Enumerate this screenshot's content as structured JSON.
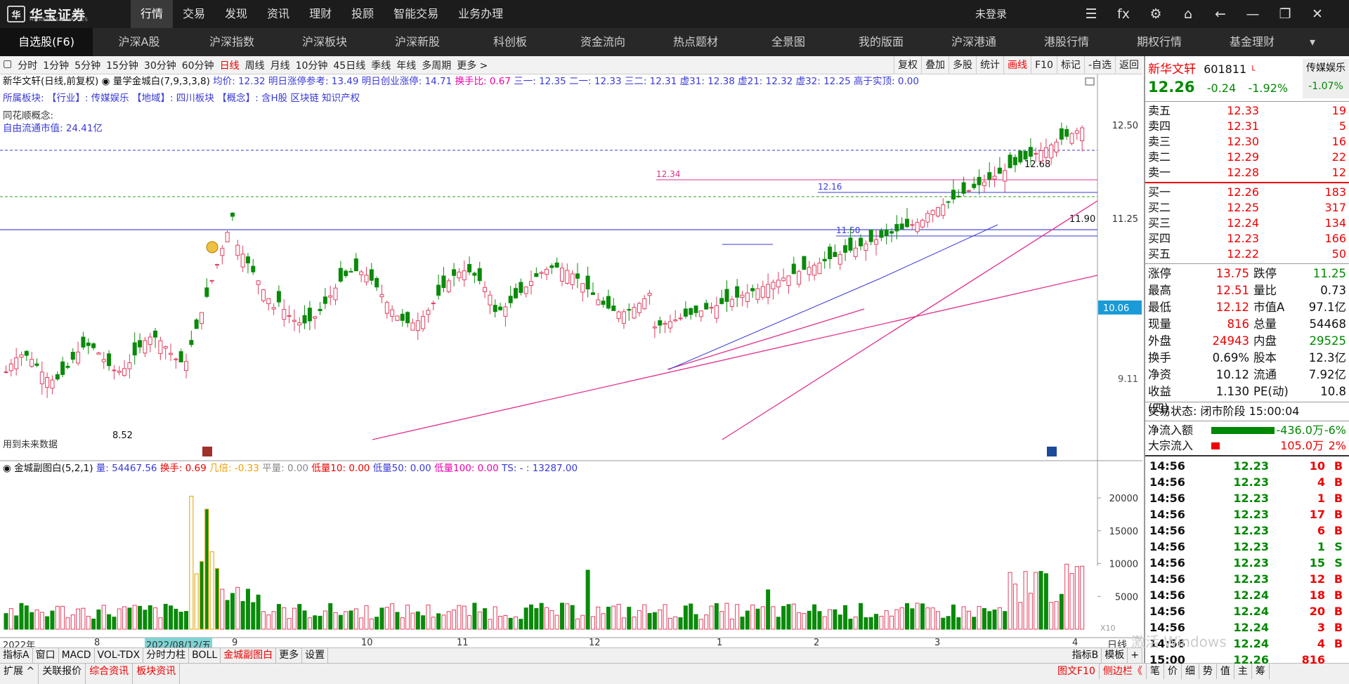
{
  "app": {
    "logo_text": "华宝证券",
    "logo_sub": "HWABAO SECURITIES",
    "login": "未登录"
  },
  "top_menu": [
    "行情",
    "交易",
    "发现",
    "资讯",
    "理财",
    "投顾",
    "智能交易",
    "业务办理"
  ],
  "top_icons": [
    "list-icon",
    "fx-icon",
    "gear-icon",
    "shirt-icon",
    "back-icon",
    "minimize-icon",
    "restore-icon",
    "close-icon"
  ],
  "top_icon_glyphs": [
    "☰",
    "fx",
    "⚙",
    "⌂",
    "←",
    "—",
    "❐",
    "✕"
  ],
  "navbar": [
    "自选股(F6)",
    "沪深A股",
    "沪深指数",
    "沪深板块",
    "沪深新股",
    "科创板",
    "资金流向",
    "热点题材",
    "全景图",
    "我的版面",
    "沪深港通",
    "港股行情",
    "期权行情",
    "基金理财"
  ],
  "periods": [
    "▢",
    "分时",
    "1分钟",
    "5分钟",
    "15分钟",
    "30分钟",
    "60分钟",
    "日线",
    "周线",
    "月线",
    "10分钟",
    "45日线",
    "季线",
    "年线",
    "多周期",
    "更多 >"
  ],
  "active_period": "日线",
  "tool_buttons": [
    "复权",
    "叠加",
    "多股",
    "统计",
    "画线",
    "F10",
    "标记",
    "-自选",
    "返回"
  ],
  "info_line": {
    "name": "新华文轩(日线,前复权)",
    "indicator": "量学金城白(7,9,3,3,8)",
    "avg": "均价: 12.32",
    "limit_ref": "明日涨停参考: 13.49",
    "cy_limit": "明日创业涨停: 14.71",
    "turnover": "换手比: 0.67",
    "s1": "三一: 12.35",
    "s2": "二一: 12.33",
    "s3": "三二: 12.31",
    "x31": "虚31: 12.38",
    "x21": "虚21: 12.32",
    "x32": "虚32: 12.25",
    "above": "高于实顶: 0.00"
  },
  "sector_line": "所属板块:  【行业】: 传媒娱乐   【地域】: 四川板块   【概念】: 含H股 区块链 知识产权",
  "concept_label": "同花顺概念:",
  "float_cap": "自由流通市值: 24.41亿",
  "future_note": "用到未来数据",
  "price_labels": {
    "max": "12.68",
    "min": "8.52",
    "l1": "12.34",
    "l2": "12.16",
    "l3": "11.50",
    "l4": "11.90"
  },
  "y_axis": [
    "12.50",
    "11.25",
    "10.06",
    "9.11"
  ],
  "sub_header": {
    "name": "金城副图白(5,2,1)",
    "vol": "量: 54467.56",
    "hs": "换手: 0.69",
    "jb": "几倍: -0.33",
    "pl": "平量: 0.00",
    "d10": "低量10: 0.00",
    "d50": "低量50: 0.00",
    "d100": "低量100: 0.00",
    "ts": "TS: - : 13287.00"
  },
  "vol_axis": [
    "20000",
    "15000",
    "10000",
    "5000"
  ],
  "x_axis": {
    "year": "2022年",
    "m8": "8",
    "date": "2022/08/12/五",
    "m9": "9",
    "m10": "10",
    "m11": "11",
    "m12": "12",
    "m1": "1",
    "m2": "2",
    "m3": "3",
    "m4": "4",
    "period": "日线",
    "x10": "X10"
  },
  "bottom1": [
    "指标A",
    "窗口",
    "MACD",
    "VOL-TDX",
    "分时力柱",
    "BOLL",
    "金城副图白",
    "更多",
    "设置"
  ],
  "bottom1_right": [
    "指标B",
    "模板",
    "+"
  ],
  "bottom2": [
    "扩展 ^",
    "关联报价",
    "综合资讯",
    "板块资讯"
  ],
  "bottom2_right": [
    "图文F10",
    "侧边栏《",
    "笔",
    "价",
    "细",
    "势",
    "值",
    "主",
    "筹"
  ],
  "stock": {
    "name": "新华文轩",
    "code": "601811",
    "price": "12.26",
    "change": "-0.24",
    "pct": "-1.92%",
    "sector": "传媒娱乐",
    "sector_pct": "-1.07%"
  },
  "asks": [
    [
      "卖五",
      "12.33",
      "19"
    ],
    [
      "卖四",
      "12.31",
      "5"
    ],
    [
      "卖三",
      "12.30",
      "16"
    ],
    [
      "卖二",
      "12.29",
      "22"
    ],
    [
      "卖一",
      "12.28",
      "12"
    ]
  ],
  "bids": [
    [
      "买一",
      "12.26",
      "183"
    ],
    [
      "买二",
      "12.25",
      "317"
    ],
    [
      "买三",
      "12.24",
      "134"
    ],
    [
      "买四",
      "12.23",
      "166"
    ],
    [
      "买五",
      "12.22",
      "50"
    ]
  ],
  "stats": [
    [
      "涨停",
      "13.75",
      "跌停",
      "11.25"
    ],
    [
      "最高",
      "12.51",
      "量比",
      "0.73"
    ],
    [
      "最低",
      "12.12",
      "市值A",
      "97.1亿"
    ],
    [
      "现量",
      "816",
      "总量",
      "54468"
    ],
    [
      "外盘",
      "24943",
      "内盘",
      "29525"
    ],
    [
      "换手",
      "0.69%",
      "股本",
      "12.3亿"
    ],
    [
      "净资",
      "10.12",
      "流通",
      "7.92亿"
    ],
    [
      "收益(四)",
      "1.130",
      "PE(动)",
      "10.8"
    ]
  ],
  "trade_status": "交易状态: 闭市阶段 15:00:04",
  "net_inflow": {
    "label": "净流入额",
    "value": "-436.0万",
    "pct": "-6%"
  },
  "block_inflow": {
    "label": "大宗流入",
    "value": "105.0万",
    "pct": "2%"
  },
  "ticks": [
    [
      "14:56",
      "12.23",
      "10",
      "B"
    ],
    [
      "14:56",
      "12.23",
      "4",
      "B"
    ],
    [
      "14:56",
      "12.23",
      "1",
      "B"
    ],
    [
      "14:56",
      "12.23",
      "17",
      "B"
    ],
    [
      "14:56",
      "12.23",
      "6",
      "B"
    ],
    [
      "14:56",
      "12.23",
      "1",
      "S"
    ],
    [
      "14:56",
      "12.23",
      "15",
      "S"
    ],
    [
      "14:56",
      "12.23",
      "12",
      "B"
    ],
    [
      "14:56",
      "12.24",
      "18",
      "B"
    ],
    [
      "14:56",
      "12.24",
      "20",
      "B"
    ],
    [
      "14:56",
      "12.24",
      "3",
      "B"
    ],
    [
      "14:56",
      "12.24",
      "4",
      "B"
    ],
    [
      "15:00",
      "12.26",
      "816",
      ""
    ]
  ],
  "watermark": "激活 Windows"
}
